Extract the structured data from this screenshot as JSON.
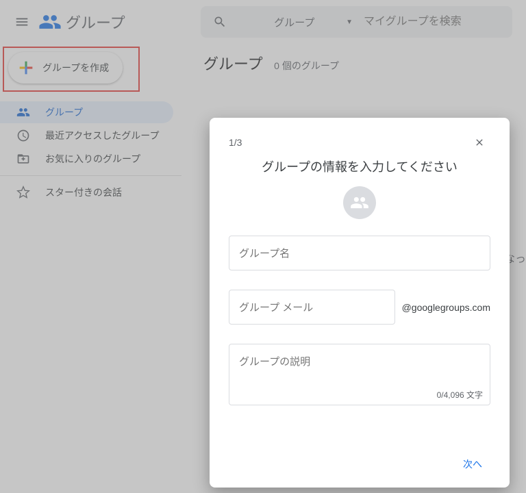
{
  "header": {
    "app_title": "グループ",
    "search_scope": "グループ",
    "search_placeholder": "マイグループを検索"
  },
  "sidebar": {
    "create_label": "グループを作成",
    "items": [
      {
        "label": "グループ"
      },
      {
        "label": "最近アクセスしたグループ"
      },
      {
        "label": "お気に入りのグループ"
      }
    ],
    "starred_label": "スター付きの会話"
  },
  "main": {
    "heading": "グループ",
    "count_label": "0 個のグループ",
    "bg_hint": "なっ"
  },
  "dialog": {
    "step": "1/3",
    "title": "グループの情報を入力してください",
    "group_name_placeholder": "グループ名",
    "group_email_placeholder": "グループ メール",
    "email_suffix": "@googlegroups.com",
    "description_placeholder": "グループの説明",
    "char_counter": "0/4,096 文字",
    "next_label": "次へ"
  }
}
